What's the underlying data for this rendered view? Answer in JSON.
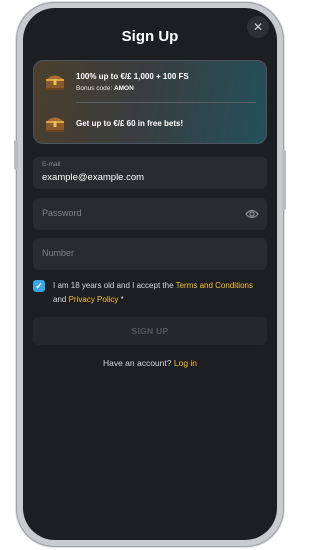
{
  "modal": {
    "title": "Sign Up",
    "close_glyph": "✕"
  },
  "bonus": {
    "offer1_main": "100% up to €/£ 1,000 + 100 FS",
    "offer1_code_label": "Bonus code:",
    "offer1_code": "AMON",
    "offer2_main": "Get up to €/£ 60 in free bets!",
    "icon": "treasure-chest-icon"
  },
  "form": {
    "email_label": "E-mail",
    "email_value": "example@example.com",
    "password_placeholder": "Password",
    "number_placeholder": "Number",
    "age_text_1": "I am 18 years old and I accept the",
    "terms_link": "Terms and Conditions",
    "and_text": "and",
    "privacy_link": "Privacy Policy",
    "required_mark": "*",
    "checkbox_checked": true,
    "submit_label": "SIGN UP",
    "have_account": "Have an account?",
    "login_link": "Log in"
  },
  "colors": {
    "background": "#1d1e22",
    "field": "#2a2b31",
    "accent_link": "#f2c12e",
    "checkbox": "#3aa6e6"
  }
}
